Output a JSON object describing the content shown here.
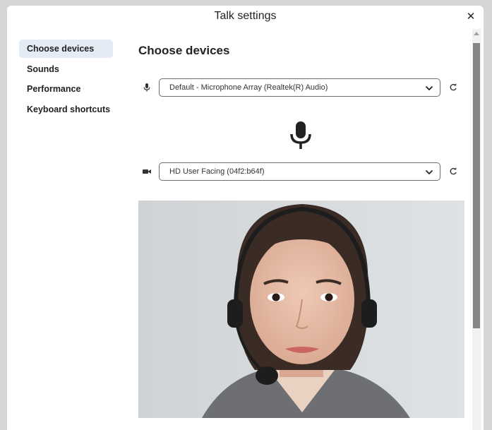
{
  "dialog": {
    "title": "Talk settings",
    "close_label": "✕"
  },
  "sidebar": {
    "items": [
      {
        "label": "Choose devices",
        "active": true
      },
      {
        "label": "Sounds",
        "active": false
      },
      {
        "label": "Performance",
        "active": false
      },
      {
        "label": "Keyboard shortcuts",
        "active": false
      }
    ]
  },
  "main": {
    "section_title": "Choose devices",
    "microphone": {
      "icon": "microphone-icon",
      "selected": "Default - Microphone Array (Realtek(R) Audio)"
    },
    "camera": {
      "icon": "video-camera-icon",
      "selected": "HD User Facing (04f2:b64f)"
    },
    "video_preview": "woman-with-headset-photo"
  },
  "colors": {
    "active_nav_bg": "#e4ebf4",
    "dialog_bg": "#ffffff",
    "overlay_bg": "#d6d6d6"
  }
}
